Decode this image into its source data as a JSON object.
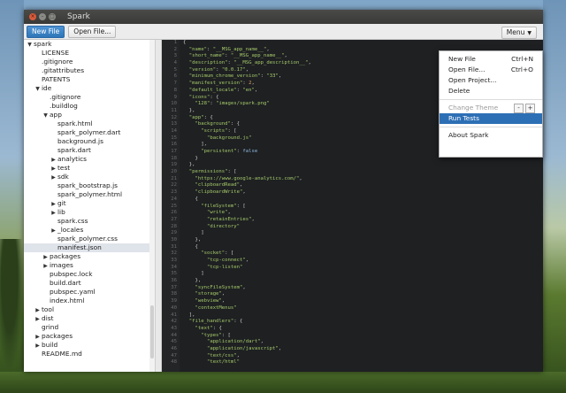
{
  "window": {
    "title": "Spark"
  },
  "toolbar": {
    "new_file": "New File",
    "open_file": "Open File...",
    "menu": "Menu"
  },
  "icons": {
    "close": "close-icon",
    "minimize": "minimize-icon",
    "maximize": "maximize-icon",
    "caret": "caret-down-icon"
  },
  "colors": {
    "primary_button": "#2e75b8",
    "menu_active": "#2d6fb5",
    "editor_bg": "#1e2022"
  },
  "tree": [
    {
      "label": "spark",
      "depth": 0,
      "arrow": "▼"
    },
    {
      "label": "LICENSE",
      "depth": 1,
      "arrow": ""
    },
    {
      "label": ".gitignore",
      "depth": 1,
      "arrow": ""
    },
    {
      "label": ".gitattributes",
      "depth": 1,
      "arrow": ""
    },
    {
      "label": "PATENTS",
      "depth": 1,
      "arrow": ""
    },
    {
      "label": "ide",
      "depth": 1,
      "arrow": "▼"
    },
    {
      "label": ".gitignore",
      "depth": 2,
      "arrow": ""
    },
    {
      "label": ".buildlog",
      "depth": 2,
      "arrow": ""
    },
    {
      "label": "app",
      "depth": 2,
      "arrow": "▼"
    },
    {
      "label": "spark.html",
      "depth": 3,
      "arrow": ""
    },
    {
      "label": "spark_polymer.dart",
      "depth": 3,
      "arrow": ""
    },
    {
      "label": "background.js",
      "depth": 3,
      "arrow": ""
    },
    {
      "label": "spark.dart",
      "depth": 3,
      "arrow": ""
    },
    {
      "label": "analytics",
      "depth": 3,
      "arrow": "▶"
    },
    {
      "label": "test",
      "depth": 3,
      "arrow": "▶"
    },
    {
      "label": "sdk",
      "depth": 3,
      "arrow": "▶"
    },
    {
      "label": "spark_bootstrap.js",
      "depth": 3,
      "arrow": ""
    },
    {
      "label": "spark_polymer.html",
      "depth": 3,
      "arrow": ""
    },
    {
      "label": "git",
      "depth": 3,
      "arrow": "▶"
    },
    {
      "label": "lib",
      "depth": 3,
      "arrow": "▶"
    },
    {
      "label": "spark.css",
      "depth": 3,
      "arrow": ""
    },
    {
      "label": "_locales",
      "depth": 3,
      "arrow": "▶"
    },
    {
      "label": "spark_polymer.css",
      "depth": 3,
      "arrow": ""
    },
    {
      "label": "manifest.json",
      "depth": 3,
      "arrow": "",
      "selected": true
    },
    {
      "label": "packages",
      "depth": 2,
      "arrow": "▶"
    },
    {
      "label": "images",
      "depth": 2,
      "arrow": "▶"
    },
    {
      "label": "pubspec.lock",
      "depth": 2,
      "arrow": ""
    },
    {
      "label": "build.dart",
      "depth": 2,
      "arrow": ""
    },
    {
      "label": "pubspec.yaml",
      "depth": 2,
      "arrow": ""
    },
    {
      "label": "index.html",
      "depth": 2,
      "arrow": ""
    },
    {
      "label": "tool",
      "depth": 1,
      "arrow": "▶"
    },
    {
      "label": "dist",
      "depth": 1,
      "arrow": "▶"
    },
    {
      "label": "grind",
      "depth": 1,
      "arrow": ""
    },
    {
      "label": "packages",
      "depth": 1,
      "arrow": "▶"
    },
    {
      "label": "build",
      "depth": 1,
      "arrow": "▶"
    },
    {
      "label": "README.md",
      "depth": 1,
      "arrow": ""
    }
  ],
  "code_lines": [
    "{",
    "  \"name\": \"__MSG_app_name__\",",
    "  \"short_name\": \"__MSG_app_name__\",",
    "  \"description\": \"__MSG_app_description__\",",
    "  \"version\": \"0.0.17\",",
    "  \"minimum_chrome_version\": \"33\",",
    "  \"manifest_version\": 2,",
    "  \"default_locale\": \"en\",",
    "  \"icons\": {",
    "    \"128\": \"images/spark.png\"",
    "  },",
    "  \"app\": {",
    "    \"background\": {",
    "      \"scripts\": [",
    "        \"background.js\"",
    "      ],",
    "      \"persistent\": false",
    "    }",
    "  },",
    "  \"permissions\": [",
    "    \"https://www.google-analytics.com/\",",
    "    \"clipboardRead\",",
    "    \"clipboardWrite\",",
    "    {",
    "      \"fileSystem\": [",
    "        \"write\",",
    "        \"retainEntries\",",
    "        \"directory\"",
    "      ]",
    "    },",
    "    {",
    "      \"socket\": [",
    "        \"tcp-connect\",",
    "        \"tcp-listen\"",
    "      ]",
    "    },",
    "    \"syncFileSystem\",",
    "    \"storage\",",
    "    \"webview\",",
    "    \"contextMenus\"",
    "  ],",
    "  \"file_handlers\": {",
    "    \"text\": {",
    "      \"types\": [",
    "        \"application/dart\",",
    "        \"application/javascript\",",
    "        \"text/css\",",
    "        \"text/html\""
  ],
  "menu": {
    "items": [
      {
        "label": "New File",
        "shortcut": "Ctrl+N"
      },
      {
        "label": "Open File...",
        "shortcut": "Ctrl+O"
      },
      {
        "label": "Open Project...",
        "shortcut": ""
      },
      {
        "label": "Delete",
        "shortcut": ""
      }
    ],
    "change_theme": "Change Theme",
    "theme_minus": "-",
    "theme_plus": "+",
    "run_tests": "Run Tests",
    "about": "About Spark"
  }
}
